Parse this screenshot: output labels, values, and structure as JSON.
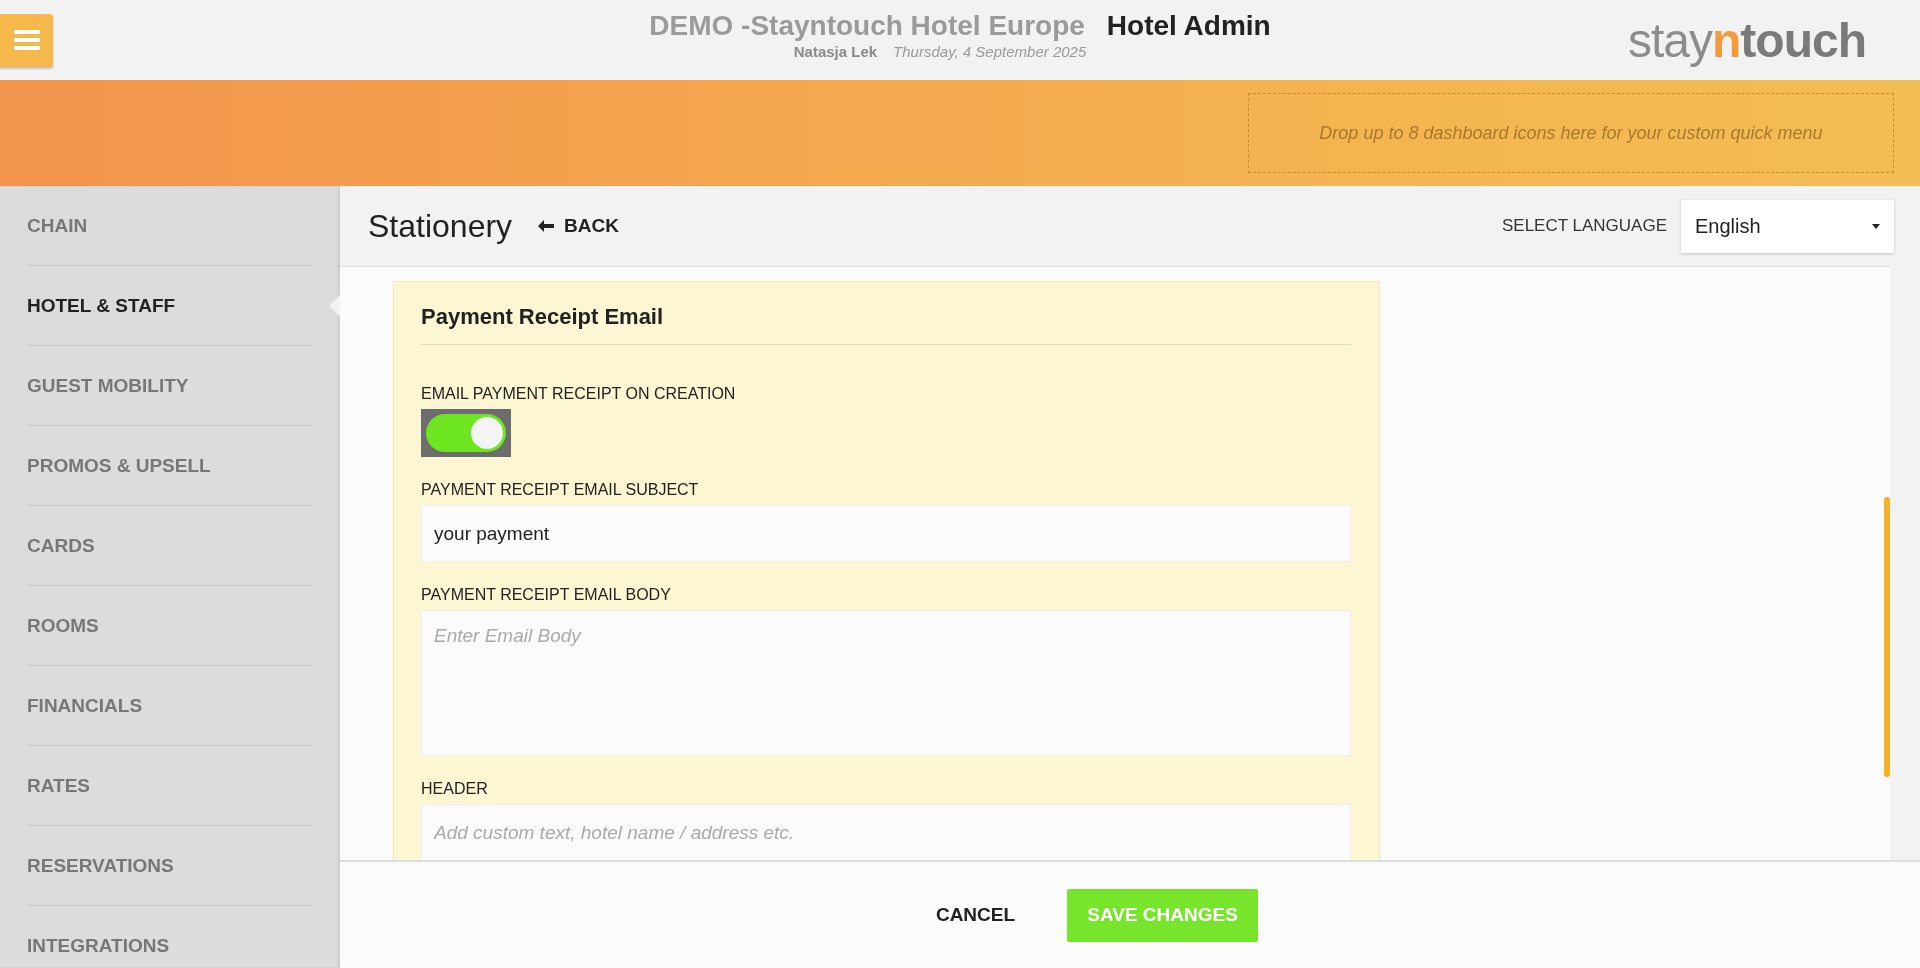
{
  "header": {
    "hotel_name": "DEMO -Stayntouch Hotel Europe",
    "app_name": "Hotel Admin",
    "user": "Natasja Lek",
    "date": "Thursday, 4 September 2025",
    "logo": [
      {
        "text": "stay",
        "color": "#8c8c8c",
        "bold": false
      },
      {
        "text": "n",
        "color": "#f39a3c",
        "bold": true
      },
      {
        "text": "touch",
        "color": "#7a7a7a",
        "bold": true
      }
    ]
  },
  "quick_menu": {
    "placeholder": "Drop up to 8 dashboard icons here for your custom quick menu"
  },
  "sidebar": {
    "items": [
      {
        "label": "CHAIN",
        "selected": false
      },
      {
        "label": "HOTEL & STAFF",
        "selected": true
      },
      {
        "label": "GUEST MOBILITY",
        "selected": false
      },
      {
        "label": "PROMOS & UPSELL",
        "selected": false
      },
      {
        "label": "CARDS",
        "selected": false
      },
      {
        "label": "ROOMS",
        "selected": false
      },
      {
        "label": "FINANCIALS",
        "selected": false
      },
      {
        "label": "RATES",
        "selected": false
      },
      {
        "label": "RESERVATIONS",
        "selected": false
      },
      {
        "label": "INTEGRATIONS",
        "selected": false
      }
    ]
  },
  "page": {
    "title": "Stationery",
    "back": "BACK",
    "language_label": "SELECT LANGUAGE",
    "language": "English"
  },
  "card": {
    "title": "Payment Receipt Email",
    "fields": [
      {
        "kind": "toggle",
        "label": "EMAIL PAYMENT RECEIPT ON CREATION",
        "on": true,
        "focused": true
      },
      {
        "kind": "text",
        "label": "PAYMENT RECEIPT EMAIL SUBJECT",
        "value": "your payment"
      },
      {
        "kind": "textarea",
        "label": "PAYMENT RECEIPT EMAIL BODY",
        "placeholder": "Enter Email Body"
      },
      {
        "kind": "text",
        "label": "HEADER",
        "placeholder": "Add custom text, hotel name / address etc."
      }
    ]
  },
  "footer": {
    "cancel": "CANCEL",
    "save": "SAVE CHANGES"
  }
}
